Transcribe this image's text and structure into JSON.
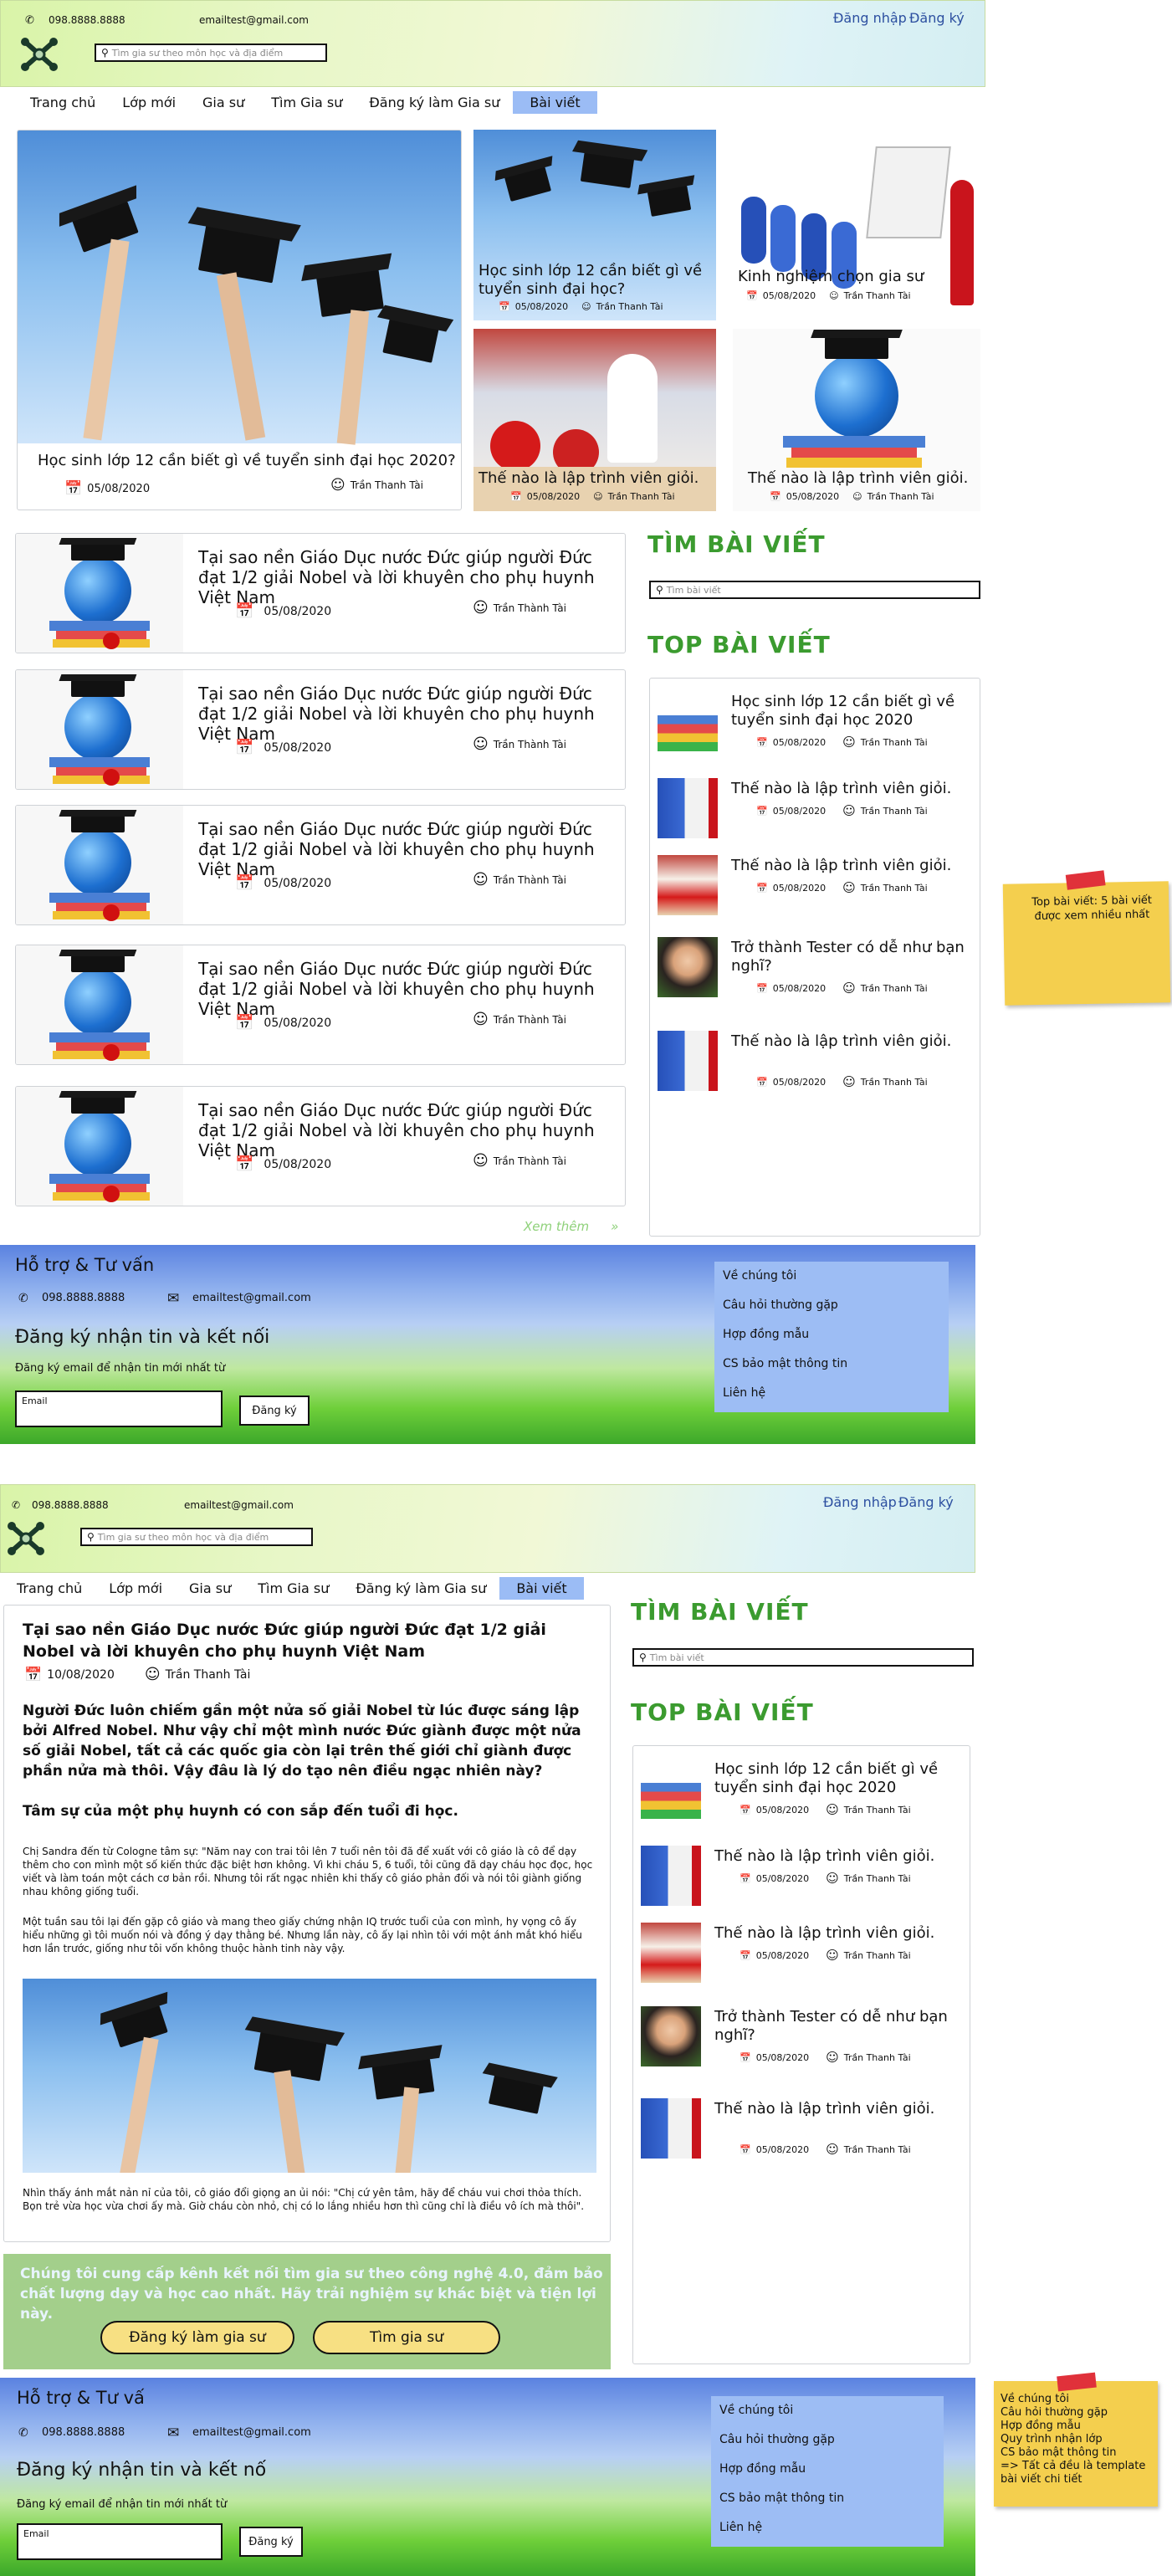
{
  "page1": {
    "header": {
      "phone": "098.8888.8888",
      "email": "emailtest@gmail.com",
      "search_placeholder": "Tìm gia sư theo môn học và địa điểm",
      "login": "Đăng nhập",
      "register": "Đăng ký"
    },
    "nav": [
      "Trang chủ",
      "Lớp mới",
      "Gia sư",
      "Tìm Gia sư",
      "Đăng ký làm Gia sư",
      "Bài viết"
    ],
    "featured": {
      "big": {
        "title": "Học sinh lớp 12 cần biết gì về tuyển sinh đại học 2020?",
        "date": "05/08/2020",
        "author": "Trần Thanh Tài"
      },
      "t1": {
        "title": "Học sinh lớp 12 cần biết gì về tuyển sinh đại học?",
        "date": "05/08/2020",
        "author": "Trần Thanh Tài"
      },
      "t2": {
        "title": "Kinh nghiệm chọn gia sư",
        "date": "05/08/2020",
        "author": "Trần Thanh Tài"
      },
      "t3": {
        "title": "Thế nào là lập trình viên giỏi.",
        "date": "05/08/2020",
        "author": "Trần Thanh Tài"
      },
      "t4": {
        "title": "Thế nào là lập trình viên giỏi.",
        "date": "05/08/2020",
        "author": "Trần Thanh Tài"
      }
    },
    "list": [
      {
        "title": "Tại sao nền Giáo Dục nước Đức giúp người Đức đạt 1/2 giải Nobel và lời khuyên cho phụ huynh Việt Nam",
        "date": "05/08/2020",
        "author": "Trần Thành Tài"
      },
      {
        "title": "Tại sao nền Giáo Dục nước Đức giúp người Đức đạt 1/2 giải Nobel và lời khuyên cho phụ huynh Việt Nam",
        "date": "05/08/2020",
        "author": "Trần Thành Tài"
      },
      {
        "title": "Tại sao nền Giáo Dục nước Đức giúp người Đức đạt 1/2 giải Nobel và lời khuyên cho phụ huynh Việt Nam",
        "date": "05/08/2020",
        "author": "Trần Thành Tài"
      },
      {
        "title": "Tại sao nền Giáo Dục nước Đức giúp người Đức đạt 1/2 giải Nobel và lời khuyên cho phụ huynh Việt Nam",
        "date": "05/08/2020",
        "author": "Trần Thành Tài"
      },
      {
        "title": "Tại sao nền Giáo Dục nước Đức giúp người Đức đạt 1/2 giải Nobel và lời khuyên cho phụ huynh Việt Nam",
        "date": "05/08/2020",
        "author": "Trần Thành Tài"
      }
    ],
    "see_more": "Xem thêm",
    "search_title": "TÌM BÀI VIẾT",
    "search_placeholder": "Tìm bài viết",
    "top_title": "TOP BÀI VIẾT",
    "top": [
      {
        "title": "Học sinh lớp 12 cần biết gì về tuyển sinh đại học 2020",
        "date": "05/08/2020",
        "author": "Trần Thanh Tài"
      },
      {
        "title": "Thế nào là lập trình viên giỏi.",
        "date": "05/08/2020",
        "author": "Trần Thanh Tài"
      },
      {
        "title": "Thế nào là lập trình viên giỏi.",
        "date": "05/08/2020",
        "author": "Trần Thanh Tài"
      },
      {
        "title": "Trở thành Tester có dễ như bạn nghĩ?",
        "date": "05/08/2020",
        "author": "Trần Thanh Tài"
      },
      {
        "title": "Thế nào là lập trình viên giỏi.",
        "date": "05/08/2020",
        "author": "Trần Thanh Tài"
      }
    ],
    "sticky": "Top bài viết: 5 bài viết được xem nhiều nhất"
  },
  "footer": {
    "support": "Hỗ trợ & Tư vấn",
    "support2": "Hỗ trợ & Tư vấ",
    "phone": "098.8888.8888",
    "email": "emailtest@gmail.com",
    "subscribe_title": "Đăng ký nhận tin và kết nối",
    "subscribe_title2": "Đăng ký nhận tin và kết nố",
    "subscribe_sub": "Đăng ký email để nhận tin mới nhất từ",
    "email_label": "Email",
    "submit": "Đăng ký",
    "links": [
      "Về chúng tôi",
      "Câu hỏi thường gặp",
      "Hợp đồng mẫu",
      "CS bảo mật thông tin",
      "Liên hệ"
    ]
  },
  "page2": {
    "nav": [
      "Trang chủ",
      "Lớp mới",
      "Gia sư",
      "Tìm Gia sư",
      "Đăng ký làm Gia sư",
      "Bài viết"
    ],
    "article": {
      "title": "Tại sao nền Giáo Dục nước Đức giúp người Đức đạt 1/2 giải Nobel và lời khuyên cho phụ huynh Việt Nam",
      "date": "10/08/2020",
      "author": "Trần Thanh Tài",
      "lead": "Người Đức luôn chiếm gần một nửa số giải Nobel từ lúc được sáng lập bởi Alfred Nobel. Như vậy chỉ một mình nước Đức giành được một nửa số giải Nobel, tất cả các quốc gia còn lại trên thế giới chỉ giành được phần nửa mà thôi. Vậy đâu là lý do tạo nên điều ngạc nhiên này?",
      "subhead": "Tâm sự của một phụ huynh có con sắp đến tuổi đi học.",
      "p1": "Chị Sandra đến từ Cologne tâm sự: \"Năm nay con trai tôi lên 7 tuổi nên tôi đã để xuất với cô giáo là cô để dạy thêm cho con mình một số kiến thức đặc biệt hơn không. Vì khi cháu 5, 6 tuổi, tôi cũng đã dạy cháu học đọc, học viết và làm toán một cách cơ bản rồi. Nhưng tôi rất ngạc nhiên khi thấy cô giáo phản đối và nói tôi giành giống nhau không giống tuổi.",
      "p2": "Một tuần sau tôi lại đến gặp cô giáo và mang theo giấy chứng nhận IQ trước tuổi của con mình, hy vọng cô ấy hiểu những gì tôi muốn nói và đồng ý dạy thằng bé. Nhưng lần này, cô ấy lại nhìn tôi với một ánh mắt khó hiểu hơn lần trước, giống như tôi vốn không thuộc hành tinh này vậy.",
      "p3": "Nhìn thấy ánh mắt nản nỉ của tôi, cô giáo đổi giọng an ủi nói: \"Chị cứ yên tâm, hãy để cháu vui chơi thỏa thích. Bọn trẻ vừa học vừa chơi ấy mà. Giờ cháu còn nhỏ, chị có lo lắng nhiều hơn thì cũng chỉ là điều vô ích mà thôi\"."
    },
    "cta": {
      "text": "Chúng tôi cung cấp kênh kết nối tìm gia sư theo công nghệ 4.0, đảm bảo chất lượng dạy và học cao nhất. Hãy trải nghiệm sự khác biệt và tiện lợi này.",
      "btn1": "Đăng ký làm gia sư",
      "btn2": "Tìm gia sư"
    },
    "sticky": [
      "Về chúng tôi",
      "Câu hỏi thường gặp",
      "Hợp đồng mẫu",
      "Quy trình nhận lớp",
      "CS bảo mật thông tin",
      "=> Tất cả đều là template",
      "bài viết chi tiết"
    ]
  }
}
